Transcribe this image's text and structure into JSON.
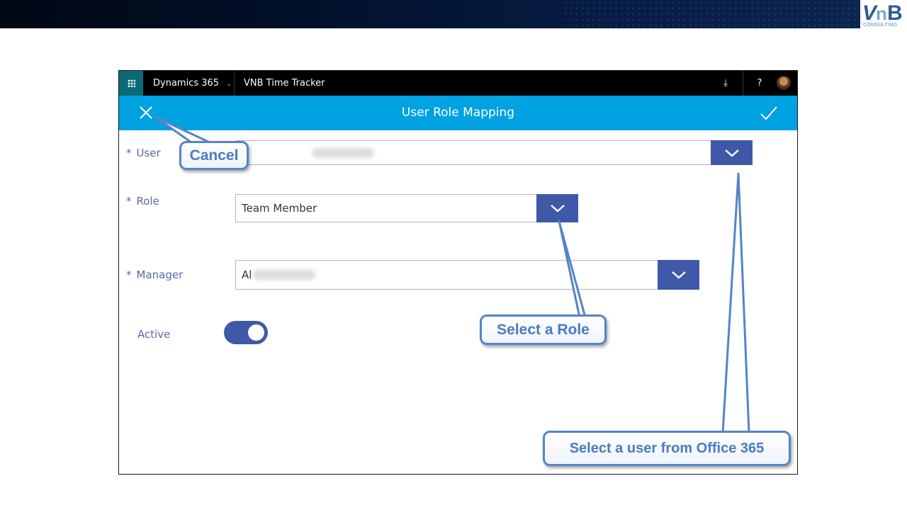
{
  "slide": {
    "logo_text": "CONSULTING",
    "logo_mark": "VnB"
  },
  "topbar": {
    "app_label": "Dynamics 365",
    "app_title": "VNB Time Tracker",
    "download_icon": "download-icon",
    "help_label": "?"
  },
  "header": {
    "title": "User Role Mapping",
    "cancel_icon": "close-icon",
    "save_icon": "checkmark-icon"
  },
  "form": {
    "required_mark": "*",
    "user": {
      "label": "User"
    },
    "role": {
      "label": "Role",
      "value": "Team Member"
    },
    "manager": {
      "label": "Manager",
      "value_prefix": "Al"
    },
    "active": {
      "label": "Active",
      "value": true
    }
  },
  "callouts": {
    "cancel": "Cancel",
    "select_role": "Select a Role",
    "select_user": "Select a user from Office 365"
  },
  "colors": {
    "header_bg": "#00a2e1",
    "accent": "#3f59a8",
    "label": "#5b6aa0",
    "callout_text": "#4a7cc0",
    "callout_border": "#5584c6",
    "topbar_bg": "#000000",
    "waffle_bg": "#0b6a78"
  }
}
